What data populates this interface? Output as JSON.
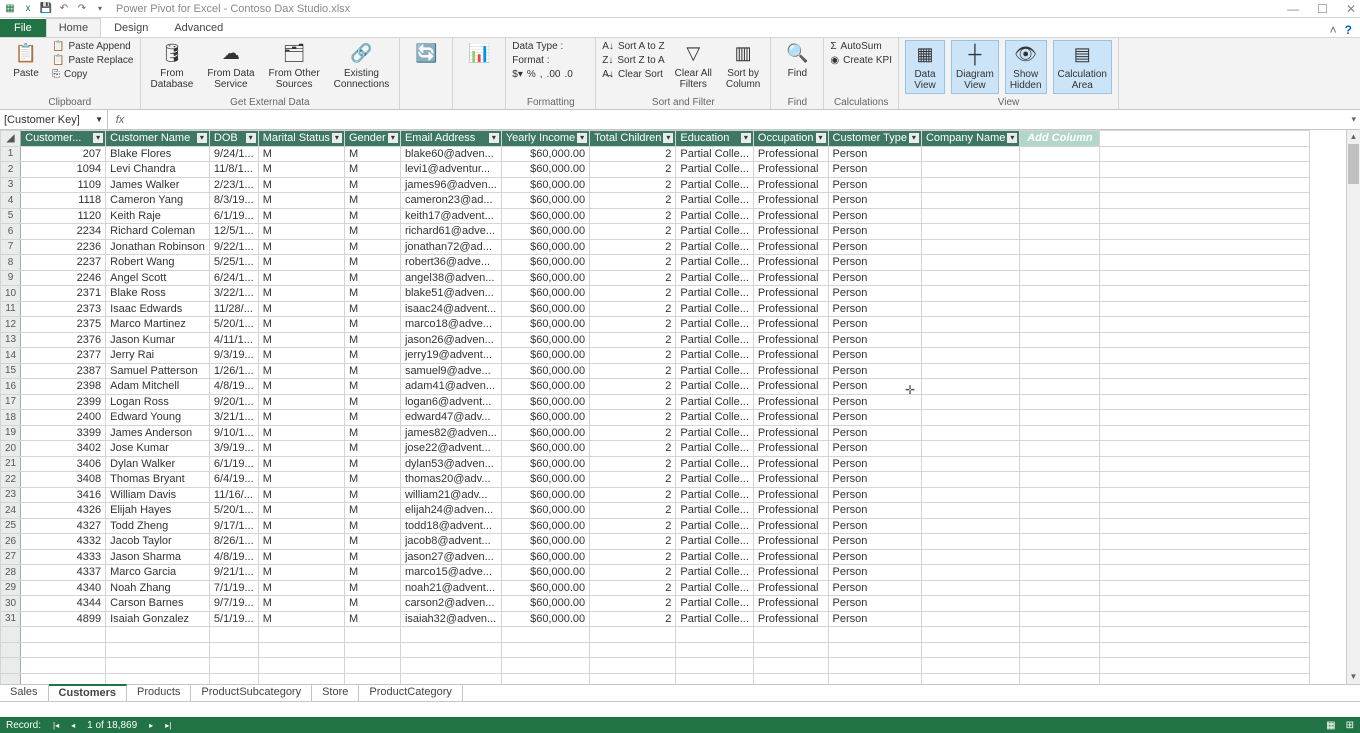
{
  "title": "Power Pivot for Excel - Contoso Dax Studio.xlsx",
  "ribbon": {
    "file": "File",
    "tabs": [
      "Home",
      "Design",
      "Advanced"
    ],
    "active_tab": "Home",
    "groups": {
      "clipboard": {
        "label": "Clipboard",
        "paste": "Paste",
        "paste_append": "Paste Append",
        "paste_replace": "Paste Replace",
        "copy": "Copy"
      },
      "external": {
        "label": "Get External Data",
        "from_db": "From\nDatabase",
        "from_ds": "From Data\nService",
        "from_other": "From Other\nSources",
        "existing": "Existing\nConnections"
      },
      "refresh": "Refresh",
      "pivot": "PivotTable",
      "formatting": {
        "label": "Formatting",
        "datatype": "Data Type :",
        "format": "Format :"
      },
      "sortfilter": {
        "label": "Sort and Filter",
        "az": "Sort A to Z",
        "za": "Sort Z to A",
        "clearsort": "Clear Sort",
        "clearfilt": "Clear All\nFilters",
        "sortcol": "Sort by\nColumn"
      },
      "find": {
        "label": "Find",
        "find": "Find"
      },
      "calc": {
        "label": "Calculations",
        "autosum": "AutoSum",
        "kpi": "Create KPI"
      },
      "view": {
        "label": "View",
        "data": "Data\nView",
        "diagram": "Diagram\nView",
        "hidden": "Show\nHidden",
        "calcarea": "Calculation\nArea"
      }
    }
  },
  "namebox": "[Customer Key]",
  "add_column": "Add Column",
  "columns": [
    {
      "key": "customer_key",
      "label": "Customer...",
      "w": 85,
      "align": "num"
    },
    {
      "key": "customer_name",
      "label": "Customer Name",
      "w": 92
    },
    {
      "key": "dob",
      "label": "DOB",
      "w": 47
    },
    {
      "key": "marital",
      "label": "Marital Status",
      "w": 84
    },
    {
      "key": "gender",
      "label": "Gender",
      "w": 56
    },
    {
      "key": "email",
      "label": "Email Address",
      "w": 85
    },
    {
      "key": "income",
      "label": "Yearly Income",
      "w": 84,
      "align": "num"
    },
    {
      "key": "children",
      "label": "Total Children",
      "w": 82,
      "align": "num"
    },
    {
      "key": "education",
      "label": "Education",
      "w": 65
    },
    {
      "key": "occupation",
      "label": "Occupation",
      "w": 73
    },
    {
      "key": "ctype",
      "label": "Customer Type",
      "w": 88
    },
    {
      "key": "company",
      "label": "Company Name",
      "w": 96
    }
  ],
  "add_col_w": 80,
  "blank_w": 210,
  "rows": [
    {
      "customer_key": 207,
      "customer_name": "Blake Flores",
      "dob": "9/24/1...",
      "marital": "M",
      "gender": "M",
      "email": "blake60@adven...",
      "income": "$60,000.00",
      "children": 2,
      "education": "Partial Colle...",
      "occupation": "Professional",
      "ctype": "Person",
      "company": ""
    },
    {
      "customer_key": 1094,
      "customer_name": "Levi Chandra",
      "dob": "11/8/1...",
      "marital": "M",
      "gender": "M",
      "email": "levi1@adventur...",
      "income": "$60,000.00",
      "children": 2,
      "education": "Partial Colle...",
      "occupation": "Professional",
      "ctype": "Person",
      "company": ""
    },
    {
      "customer_key": 1109,
      "customer_name": "James Walker",
      "dob": "2/23/1...",
      "marital": "M",
      "gender": "M",
      "email": "james96@adven...",
      "income": "$60,000.00",
      "children": 2,
      "education": "Partial Colle...",
      "occupation": "Professional",
      "ctype": "Person",
      "company": ""
    },
    {
      "customer_key": 1118,
      "customer_name": "Cameron Yang",
      "dob": "8/3/19...",
      "marital": "M",
      "gender": "M",
      "email": "cameron23@ad...",
      "income": "$60,000.00",
      "children": 2,
      "education": "Partial Colle...",
      "occupation": "Professional",
      "ctype": "Person",
      "company": ""
    },
    {
      "customer_key": 1120,
      "customer_name": "Keith Raje",
      "dob": "6/1/19...",
      "marital": "M",
      "gender": "M",
      "email": "keith17@advent...",
      "income": "$60,000.00",
      "children": 2,
      "education": "Partial Colle...",
      "occupation": "Professional",
      "ctype": "Person",
      "company": ""
    },
    {
      "customer_key": 2234,
      "customer_name": "Richard Coleman",
      "dob": "12/5/1...",
      "marital": "M",
      "gender": "M",
      "email": "richard61@adve...",
      "income": "$60,000.00",
      "children": 2,
      "education": "Partial Colle...",
      "occupation": "Professional",
      "ctype": "Person",
      "company": ""
    },
    {
      "customer_key": 2236,
      "customer_name": "Jonathan Robinson",
      "dob": "9/22/1...",
      "marital": "M",
      "gender": "M",
      "email": "jonathan72@ad...",
      "income": "$60,000.00",
      "children": 2,
      "education": "Partial Colle...",
      "occupation": "Professional",
      "ctype": "Person",
      "company": ""
    },
    {
      "customer_key": 2237,
      "customer_name": "Robert Wang",
      "dob": "5/25/1...",
      "marital": "M",
      "gender": "M",
      "email": "robert36@adve...",
      "income": "$60,000.00",
      "children": 2,
      "education": "Partial Colle...",
      "occupation": "Professional",
      "ctype": "Person",
      "company": ""
    },
    {
      "customer_key": 2246,
      "customer_name": "Angel Scott",
      "dob": "6/24/1...",
      "marital": "M",
      "gender": "M",
      "email": "angel38@adven...",
      "income": "$60,000.00",
      "children": 2,
      "education": "Partial Colle...",
      "occupation": "Professional",
      "ctype": "Person",
      "company": ""
    },
    {
      "customer_key": 2371,
      "customer_name": "Blake Ross",
      "dob": "3/22/1...",
      "marital": "M",
      "gender": "M",
      "email": "blake51@adven...",
      "income": "$60,000.00",
      "children": 2,
      "education": "Partial Colle...",
      "occupation": "Professional",
      "ctype": "Person",
      "company": ""
    },
    {
      "customer_key": 2373,
      "customer_name": "Isaac Edwards",
      "dob": "11/28/...",
      "marital": "M",
      "gender": "M",
      "email": "isaac24@advent...",
      "income": "$60,000.00",
      "children": 2,
      "education": "Partial Colle...",
      "occupation": "Professional",
      "ctype": "Person",
      "company": ""
    },
    {
      "customer_key": 2375,
      "customer_name": "Marco Martinez",
      "dob": "5/20/1...",
      "marital": "M",
      "gender": "M",
      "email": "marco18@adve...",
      "income": "$60,000.00",
      "children": 2,
      "education": "Partial Colle...",
      "occupation": "Professional",
      "ctype": "Person",
      "company": ""
    },
    {
      "customer_key": 2376,
      "customer_name": "Jason Kumar",
      "dob": "4/11/1...",
      "marital": "M",
      "gender": "M",
      "email": "jason26@adven...",
      "income": "$60,000.00",
      "children": 2,
      "education": "Partial Colle...",
      "occupation": "Professional",
      "ctype": "Person",
      "company": ""
    },
    {
      "customer_key": 2377,
      "customer_name": "Jerry Rai",
      "dob": "9/3/19...",
      "marital": "M",
      "gender": "M",
      "email": "jerry19@advent...",
      "income": "$60,000.00",
      "children": 2,
      "education": "Partial Colle...",
      "occupation": "Professional",
      "ctype": "Person",
      "company": ""
    },
    {
      "customer_key": 2387,
      "customer_name": "Samuel Patterson",
      "dob": "1/26/1...",
      "marital": "M",
      "gender": "M",
      "email": "samuel9@adve...",
      "income": "$60,000.00",
      "children": 2,
      "education": "Partial Colle...",
      "occupation": "Professional",
      "ctype": "Person",
      "company": ""
    },
    {
      "customer_key": 2398,
      "customer_name": "Adam Mitchell",
      "dob": "4/8/19...",
      "marital": "M",
      "gender": "M",
      "email": "adam41@adven...",
      "income": "$60,000.00",
      "children": 2,
      "education": "Partial Colle...",
      "occupation": "Professional",
      "ctype": "Person",
      "company": ""
    },
    {
      "customer_key": 2399,
      "customer_name": "Logan Ross",
      "dob": "9/20/1...",
      "marital": "M",
      "gender": "M",
      "email": "logan6@advent...",
      "income": "$60,000.00",
      "children": 2,
      "education": "Partial Colle...",
      "occupation": "Professional",
      "ctype": "Person",
      "company": ""
    },
    {
      "customer_key": 2400,
      "customer_name": "Edward Young",
      "dob": "3/21/1...",
      "marital": "M",
      "gender": "M",
      "email": "edward47@adv...",
      "income": "$60,000.00",
      "children": 2,
      "education": "Partial Colle...",
      "occupation": "Professional",
      "ctype": "Person",
      "company": ""
    },
    {
      "customer_key": 3399,
      "customer_name": "James Anderson",
      "dob": "9/10/1...",
      "marital": "M",
      "gender": "M",
      "email": "james82@adven...",
      "income": "$60,000.00",
      "children": 2,
      "education": "Partial Colle...",
      "occupation": "Professional",
      "ctype": "Person",
      "company": ""
    },
    {
      "customer_key": 3402,
      "customer_name": "Jose Kumar",
      "dob": "3/9/19...",
      "marital": "M",
      "gender": "M",
      "email": "jose22@advent...",
      "income": "$60,000.00",
      "children": 2,
      "education": "Partial Colle...",
      "occupation": "Professional",
      "ctype": "Person",
      "company": ""
    },
    {
      "customer_key": 3406,
      "customer_name": "Dylan Walker",
      "dob": "6/1/19...",
      "marital": "M",
      "gender": "M",
      "email": "dylan53@adven...",
      "income": "$60,000.00",
      "children": 2,
      "education": "Partial Colle...",
      "occupation": "Professional",
      "ctype": "Person",
      "company": ""
    },
    {
      "customer_key": 3408,
      "customer_name": "Thomas Bryant",
      "dob": "6/4/19...",
      "marital": "M",
      "gender": "M",
      "email": "thomas20@adv...",
      "income": "$60,000.00",
      "children": 2,
      "education": "Partial Colle...",
      "occupation": "Professional",
      "ctype": "Person",
      "company": ""
    },
    {
      "customer_key": 3416,
      "customer_name": "William Davis",
      "dob": "11/16/...",
      "marital": "M",
      "gender": "M",
      "email": "william21@adv...",
      "income": "$60,000.00",
      "children": 2,
      "education": "Partial Colle...",
      "occupation": "Professional",
      "ctype": "Person",
      "company": ""
    },
    {
      "customer_key": 4326,
      "customer_name": "Elijah Hayes",
      "dob": "5/20/1...",
      "marital": "M",
      "gender": "M",
      "email": "elijah24@adven...",
      "income": "$60,000.00",
      "children": 2,
      "education": "Partial Colle...",
      "occupation": "Professional",
      "ctype": "Person",
      "company": ""
    },
    {
      "customer_key": 4327,
      "customer_name": "Todd Zheng",
      "dob": "9/17/1...",
      "marital": "M",
      "gender": "M",
      "email": "todd18@advent...",
      "income": "$60,000.00",
      "children": 2,
      "education": "Partial Colle...",
      "occupation": "Professional",
      "ctype": "Person",
      "company": ""
    },
    {
      "customer_key": 4332,
      "customer_name": "Jacob Taylor",
      "dob": "8/26/1...",
      "marital": "M",
      "gender": "M",
      "email": "jacob8@advent...",
      "income": "$60,000.00",
      "children": 2,
      "education": "Partial Colle...",
      "occupation": "Professional",
      "ctype": "Person",
      "company": ""
    },
    {
      "customer_key": 4333,
      "customer_name": "Jason Sharma",
      "dob": "4/8/19...",
      "marital": "M",
      "gender": "M",
      "email": "jason27@adven...",
      "income": "$60,000.00",
      "children": 2,
      "education": "Partial Colle...",
      "occupation": "Professional",
      "ctype": "Person",
      "company": ""
    },
    {
      "customer_key": 4337,
      "customer_name": "Marco Garcia",
      "dob": "9/21/1...",
      "marital": "M",
      "gender": "M",
      "email": "marco15@adve...",
      "income": "$60,000.00",
      "children": 2,
      "education": "Partial Colle...",
      "occupation": "Professional",
      "ctype": "Person",
      "company": ""
    },
    {
      "customer_key": 4340,
      "customer_name": "Noah Zhang",
      "dob": "7/1/19...",
      "marital": "M",
      "gender": "M",
      "email": "noah21@advent...",
      "income": "$60,000.00",
      "children": 2,
      "education": "Partial Colle...",
      "occupation": "Professional",
      "ctype": "Person",
      "company": ""
    },
    {
      "customer_key": 4344,
      "customer_name": "Carson Barnes",
      "dob": "9/7/19...",
      "marital": "M",
      "gender": "M",
      "email": "carson2@adven...",
      "income": "$60,000.00",
      "children": 2,
      "education": "Partial Colle...",
      "occupation": "Professional",
      "ctype": "Person",
      "company": ""
    },
    {
      "customer_key": 4899,
      "customer_name": "Isaiah Gonzalez",
      "dob": "5/1/19...",
      "marital": "M",
      "gender": "M",
      "email": "isaiah32@adven...",
      "income": "$60,000.00",
      "children": 2,
      "education": "Partial Colle...",
      "occupation": "Professional",
      "ctype": "Person",
      "company": ""
    }
  ],
  "sheet_tabs": [
    "Sales",
    "Customers",
    "Products",
    "ProductSubcategory",
    "Store",
    "ProductCategory"
  ],
  "active_sheet": "Customers",
  "status": {
    "record": "Record:",
    "pos": "1 of 18,869"
  }
}
